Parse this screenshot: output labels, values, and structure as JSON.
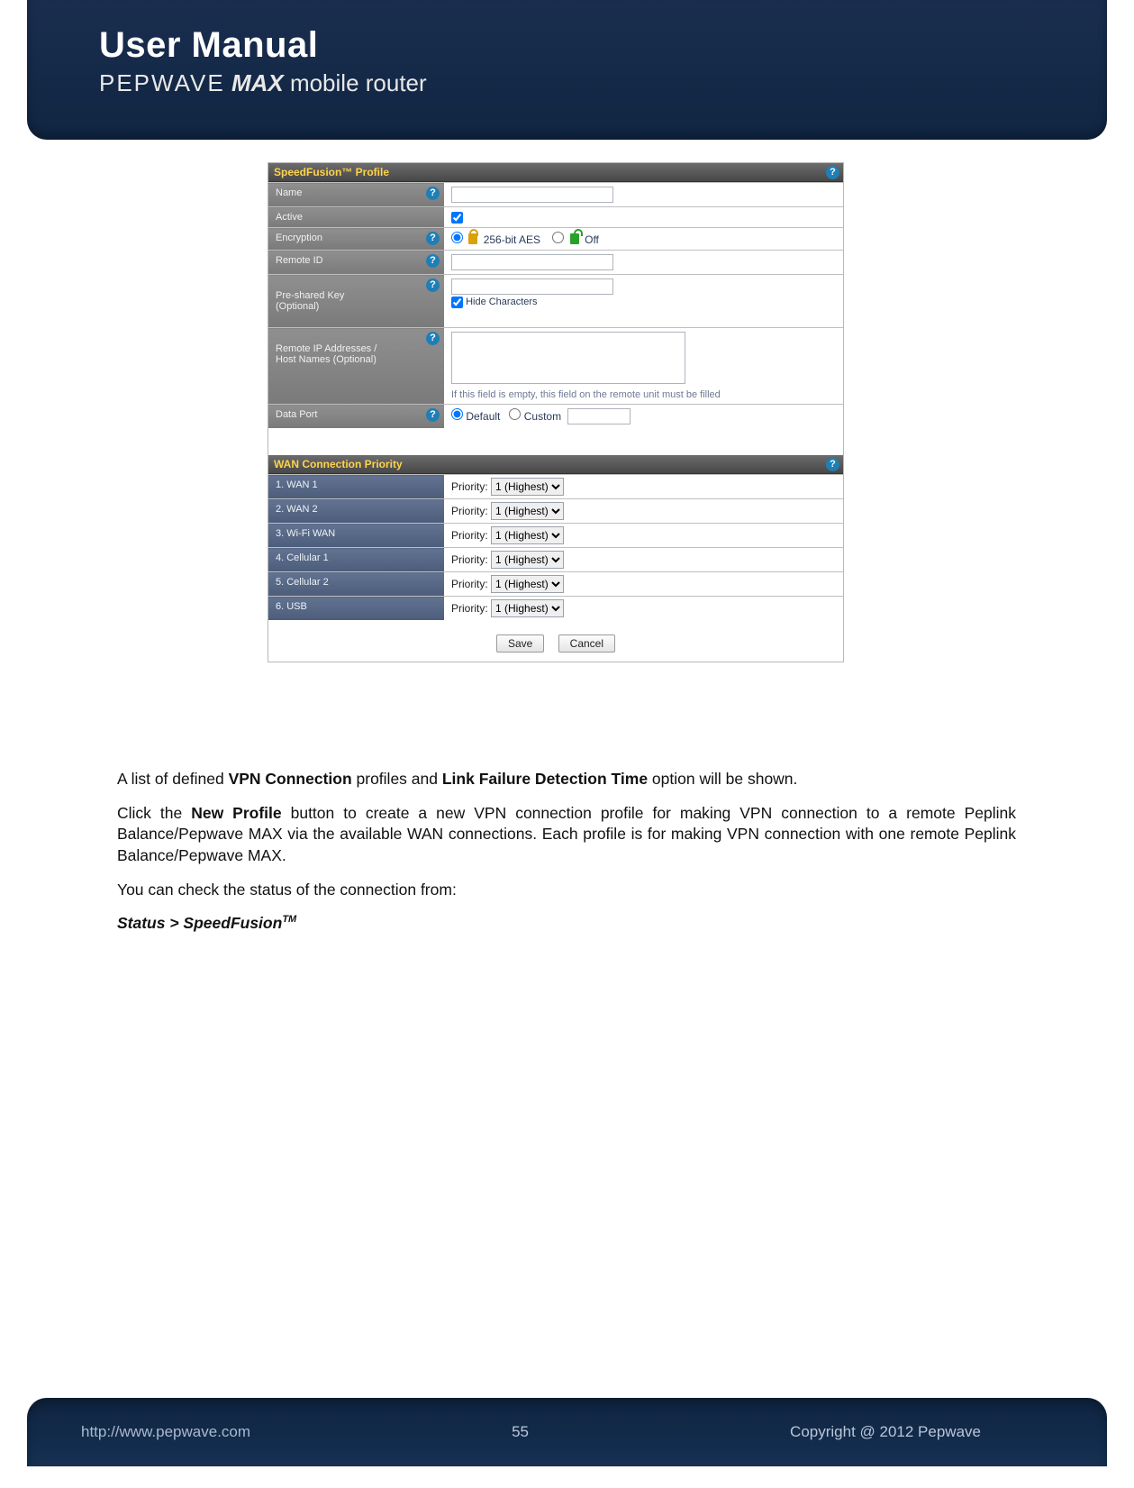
{
  "header": {
    "title": "User Manual",
    "brand": "PEPWAVE",
    "model": "MAX",
    "tail": " mobile router"
  },
  "profile_panel": {
    "title": "SpeedFusion™ Profile",
    "rows": {
      "name_label": "Name",
      "active_label": "Active",
      "encryption_label": "Encryption",
      "enc_option_aes": "256-bit AES",
      "enc_option_off": "Off",
      "remote_id_label": "Remote ID",
      "psk_label": "Pre-shared Key\n(Optional)",
      "hide_chars": "Hide Characters",
      "remote_ips_label": "Remote IP Addresses /\nHost Names (Optional)",
      "remote_ips_hint": "If this field is empty, this field on the remote unit must be filled",
      "data_port_label": "Data Port",
      "data_port_default": "Default",
      "data_port_custom": "Custom"
    }
  },
  "wan_panel": {
    "title": "WAN Connection Priority",
    "priority_label": "Priority:",
    "priority_value": "1 (Highest)",
    "items": [
      "1. WAN 1",
      "2. WAN 2",
      "3. Wi-Fi WAN",
      "4. Cellular 1",
      "5. Cellular 2",
      "6. USB"
    ]
  },
  "buttons": {
    "save": "Save",
    "cancel": "Cancel"
  },
  "copy": {
    "p1_a": "A list of defined ",
    "p1_b": "VPN Connection",
    "p1_c": " profiles and ",
    "p1_d": "Link Failure Detection Time",
    "p1_e": " option will be shown.",
    "p2_a": "Click the ",
    "p2_b": "New Profile",
    "p2_c": " button to create a new VPN connection profile for making VPN connection to a remote Peplink Balance/Pepwave MAX via the available WAN connections. Each profile is for making VPN connection with one remote Peplink Balance/Pepwave MAX.",
    "p3": "You can check the status of the connection from:",
    "p4": "Status > SpeedFusion",
    "p4_sup": "TM"
  },
  "footer": {
    "url": "http://www.pepwave.com",
    "page": "55",
    "copyright": "Copyright @ 2012 Pepwave"
  }
}
